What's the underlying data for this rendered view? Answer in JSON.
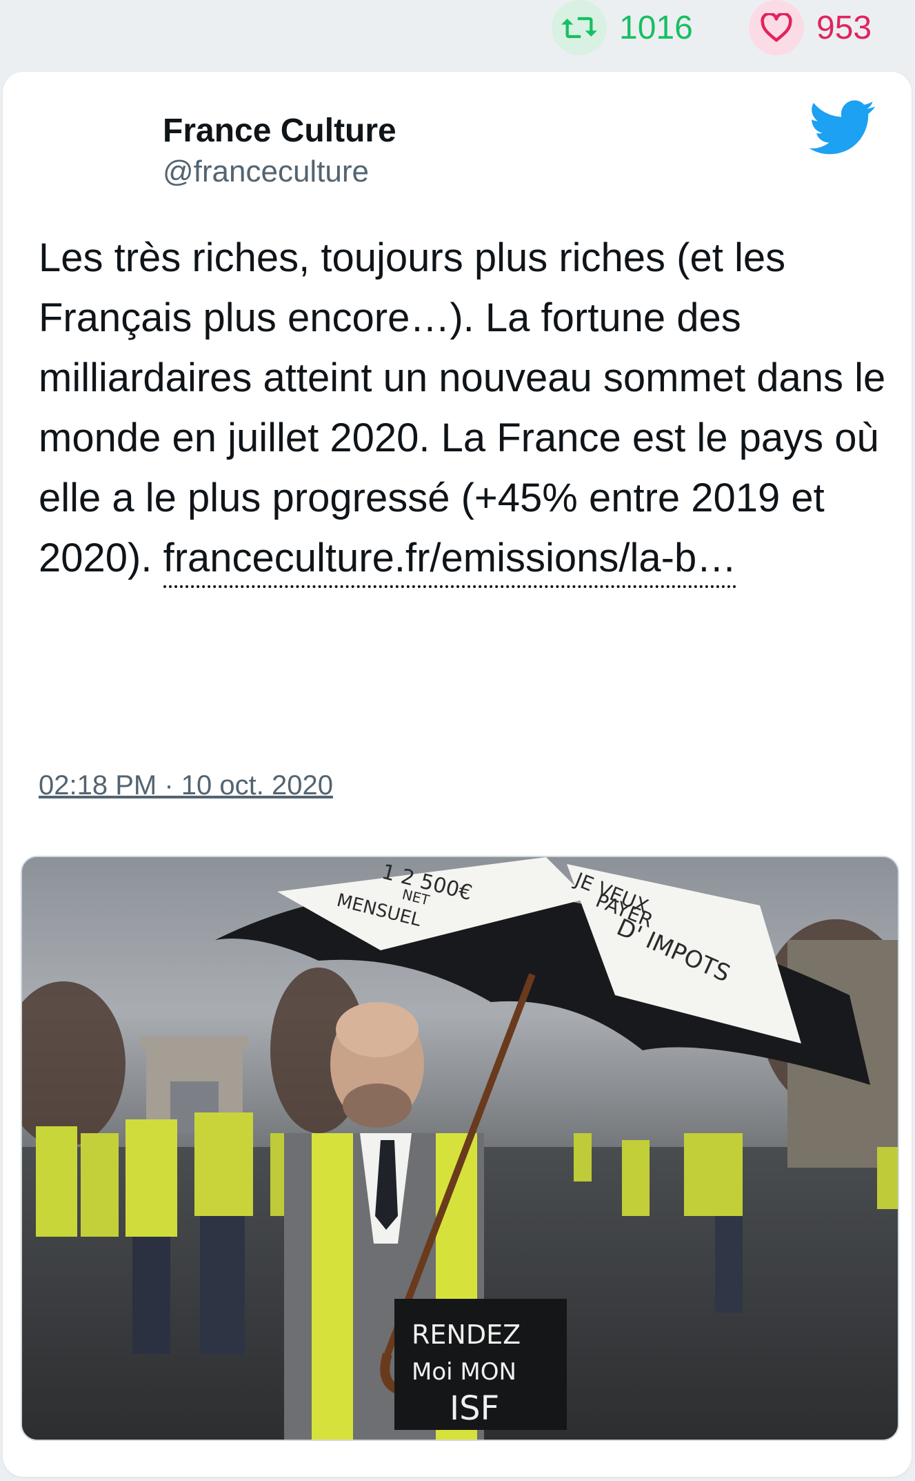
{
  "header_stats": {
    "retweets": "1016",
    "likes": "953"
  },
  "tweet": {
    "author_name": "France Culture",
    "author_handle": "@franceculture",
    "text": "Les très riches, toujours plus riches (et les Français plus encore…). La fortune des milliardaires atteint un nouveau sommet dans le monde en juillet 2020. La France est le pays où elle a le plus progressé (+45% entre 2019 et 2020).",
    "link_text": "franceculture.fr/emissions/la-b…",
    "timestamp": "02:18 PM · 10 oct. 2020"
  },
  "media": {
    "umbrella_sign_left_line1": "1 2 500€",
    "umbrella_sign_left_line2": "NET",
    "umbrella_sign_left_line3": "MENSUEL",
    "umbrella_sign_right_line1": "JE VEUX",
    "umbrella_sign_right_line2": "PAYER",
    "umbrella_sign_right_line3": "D' IMPOTS",
    "chest_sign_line1": "RENDEZ",
    "chest_sign_line2": "Moi   MON",
    "chest_sign_line3": "ISF"
  },
  "colors": {
    "retweet_green": "#17bf63",
    "like_red": "#e0245e",
    "twitter_blue": "#1da1f2",
    "secondary_text": "#536471"
  },
  "icons": {
    "retweet": "retweet-icon",
    "like": "heart-icon",
    "reply": "reply-icon",
    "brand": "twitter-bird-icon"
  }
}
